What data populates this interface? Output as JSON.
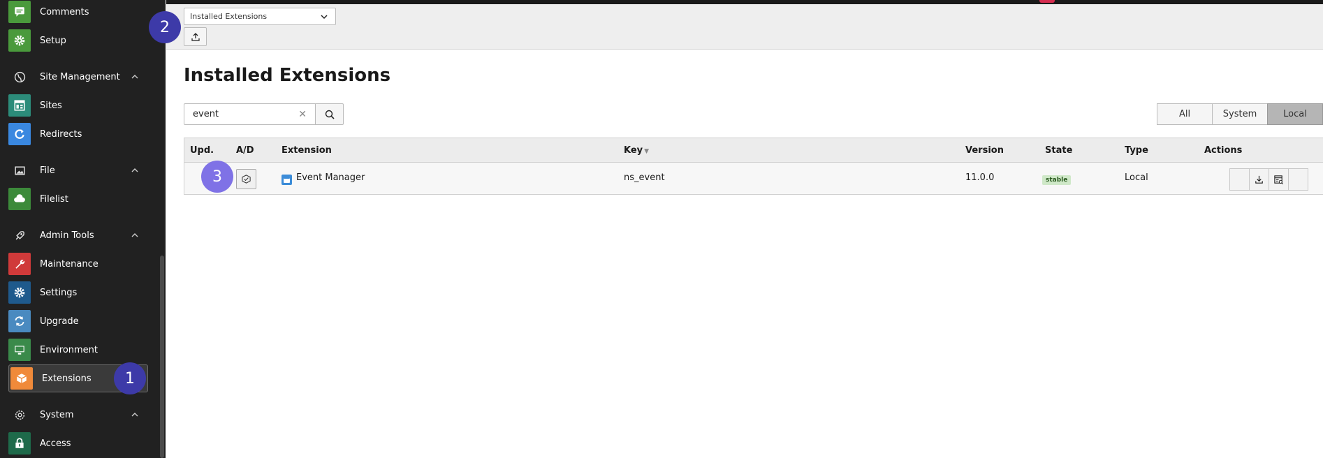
{
  "sidebar": {
    "items": [
      {
        "label": "Comments",
        "icon": "comment-icon",
        "color": "#4a9a3c"
      },
      {
        "label": "Setup",
        "icon": "gear-icon",
        "color": "#4a9a3c"
      },
      {
        "group": "Site Management",
        "icon": "globe-icon"
      },
      {
        "label": "Sites",
        "icon": "sites-icon",
        "color": "#2c8c7a"
      },
      {
        "label": "Redirects",
        "icon": "redirect-icon",
        "color": "#3a88e0"
      },
      {
        "group": "File",
        "icon": "image-icon"
      },
      {
        "label": "Filelist",
        "icon": "cloud-icon",
        "color": "#3c8a3a"
      },
      {
        "group": "Admin Tools",
        "icon": "rocket-icon"
      },
      {
        "label": "Maintenance",
        "icon": "wrench-icon",
        "color": "#d03a3a"
      },
      {
        "label": "Settings",
        "icon": "gear-icon",
        "color": "#1f5a8c"
      },
      {
        "label": "Upgrade",
        "icon": "refresh-icon",
        "color": "#4a8ac0"
      },
      {
        "label": "Environment",
        "icon": "monitor-icon",
        "color": "#3a8a4a"
      },
      {
        "label": "Extensions",
        "icon": "box-icon",
        "color": "#f08a3a"
      },
      {
        "group": "System",
        "icon": "gear-outline-icon"
      },
      {
        "label": "Access",
        "icon": "lock-icon",
        "color": "#1e6a4a"
      }
    ]
  },
  "header": {
    "select_value": "Installed Extensions"
  },
  "page": {
    "title": "Installed Extensions"
  },
  "search": {
    "value": "event"
  },
  "filters": [
    {
      "label": "All",
      "active": false
    },
    {
      "label": "System",
      "active": false
    },
    {
      "label": "Local",
      "active": true
    }
  ],
  "table": {
    "headers": [
      "Upd.",
      "A/D",
      "Extension",
      "Key",
      "Version",
      "State",
      "Type",
      "Actions"
    ],
    "rows": [
      {
        "extension": "Event Manager",
        "key": "ns_event",
        "version": "11.0.0",
        "state": "stable",
        "type": "Local"
      }
    ]
  },
  "markers": [
    "1",
    "2",
    "3"
  ],
  "colors": {
    "sidebar_bg": "#212121",
    "marker_dark": "#3d3aa8",
    "marker_light": "#7f72e6"
  }
}
